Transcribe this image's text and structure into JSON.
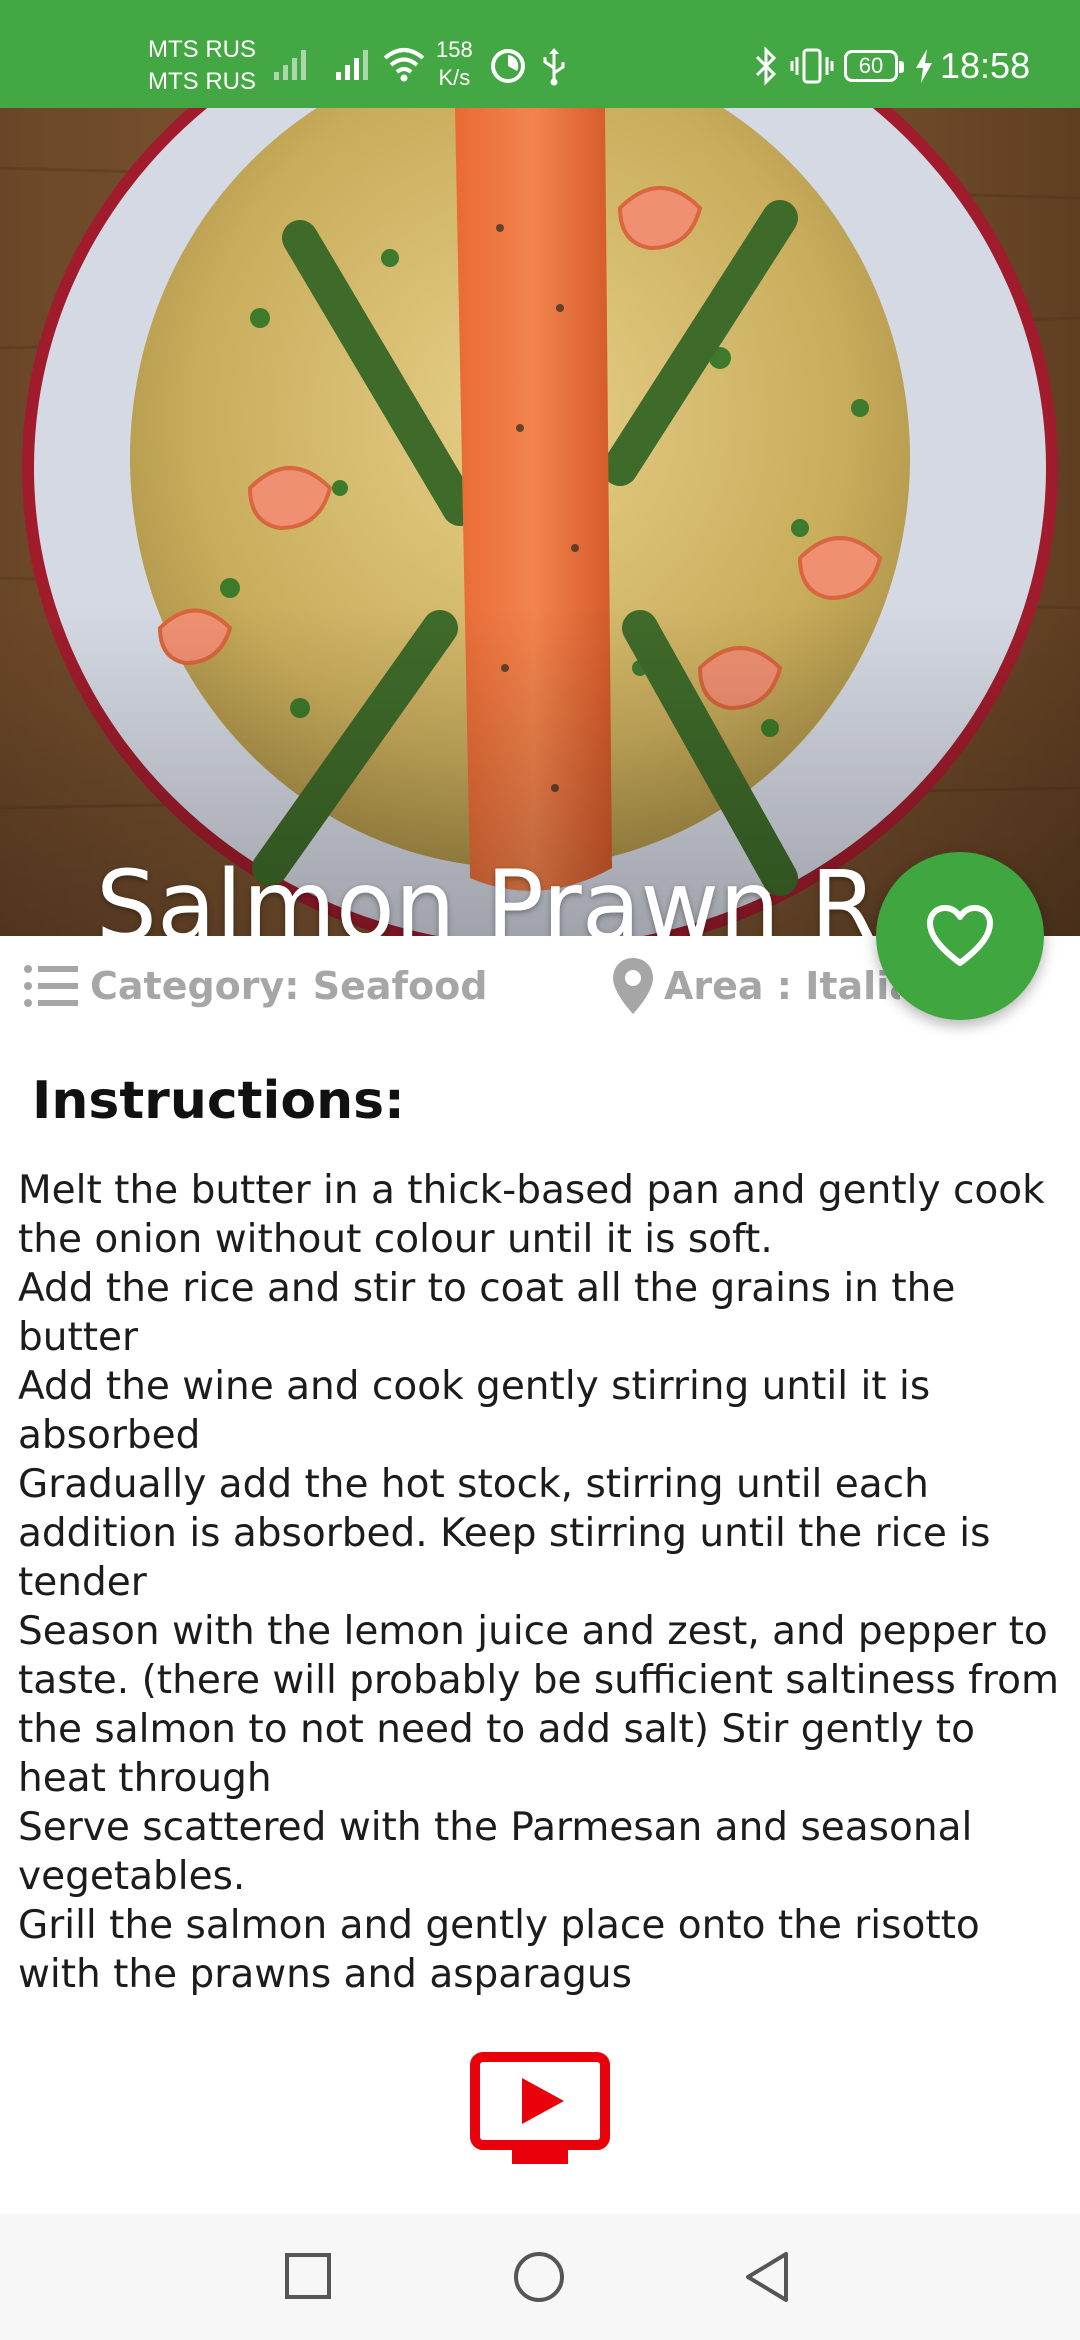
{
  "status_bar": {
    "carrier_1": "MTS RUS",
    "carrier_2": "MTS RUS",
    "net_speed_value": "158",
    "net_speed_unit": "K/s",
    "battery": "60",
    "time": "18:58",
    "icons": [
      "signal-icon",
      "wifi-icon",
      "clock-sync-icon",
      "usb-icon",
      "bluetooth-icon",
      "vibrate-icon",
      "battery-icon",
      "charging-icon"
    ]
  },
  "meal": {
    "title": "Salmon Prawn Risotto",
    "category": "Category: Seafood",
    "area": "Area : Italian"
  },
  "instructions": {
    "heading": "Instructions:",
    "body": "Melt the butter in a thick-based pan and gently cook the onion without colour until it is soft.\nAdd the rice and stir to coat all the grains in the butter\nAdd the wine and cook gently stirring until it is absorbed\nGradually add the hot stock, stirring until each addition is absorbed. Keep stirring until the rice is tender\nSeason with the lemon juice and zest, and pepper to taste. (there will probably be sufficient saltiness from the salmon to not need to add salt) Stir gently to heat through\nServe scattered with the Parmesan and seasonal vegetables.\nGrill the salmon and gently place onto the risotto with the prawns and asparagus"
  },
  "colors": {
    "accent_green": "#43a843",
    "fab_green": "#3fa640",
    "meta_gray": "#a6a6a6",
    "youtube_red": "#e8000b"
  },
  "icons": {
    "favorite": "heart-icon",
    "category": "list-icon",
    "area": "location-pin-icon",
    "video": "youtube-icon",
    "nav": [
      "recents-square-icon",
      "home-circle-icon",
      "back-triangle-icon"
    ]
  }
}
